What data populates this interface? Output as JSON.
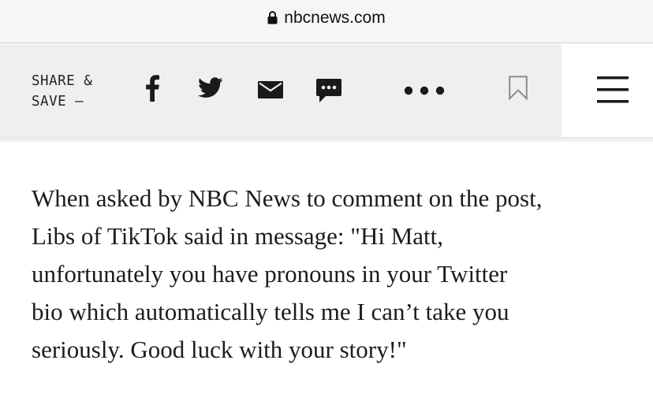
{
  "browser": {
    "url": "nbcnews.com",
    "lock_icon": "lock-icon"
  },
  "share_bar": {
    "label_line1": "SHARE &",
    "label_line2": "SAVE —",
    "icons": [
      "facebook-icon",
      "twitter-icon",
      "email-icon",
      "sms-icon",
      "more-icon",
      "bookmark-icon"
    ],
    "menu_icon": "hamburger-menu-icon"
  },
  "article": {
    "lines": [
      "When asked by NBC News to comment on the post,",
      "Libs of TikTok said in message: \"Hi Matt,",
      "unfortunately you have pronouns in your Twitter",
      "bio which automatically tells me I can’t take you",
      "seriously. Good luck with your story!\""
    ]
  }
}
